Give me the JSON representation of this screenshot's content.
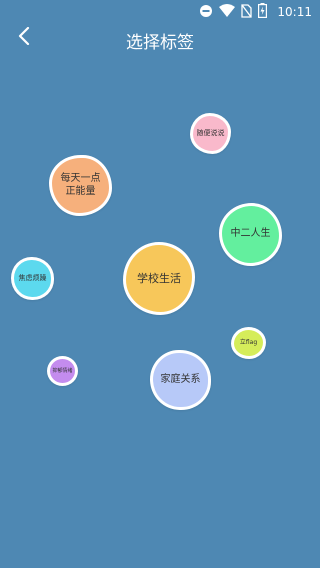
{
  "status_bar": {
    "time": "10:11",
    "icons": [
      "do-not-disturb-icon",
      "wifi-icon",
      "no-sim-icon",
      "battery-charging-icon"
    ]
  },
  "header": {
    "title": "选择标签",
    "back_icon": "chevron-left-icon"
  },
  "colors": {
    "background": "#4e88b3",
    "tag_border": "#ffffff"
  },
  "tags": [
    {
      "id": "suibian",
      "label": "随便说说",
      "color": "#f9b9cb"
    },
    {
      "id": "meitian",
      "label_line1": "每天一点",
      "label_line2": "正能量",
      "color": "#f6b07c"
    },
    {
      "id": "zhonger",
      "label": "中二人生",
      "color": "#63ef9e"
    },
    {
      "id": "xuexiao",
      "label": "学校生活",
      "color": "#f7c75a"
    },
    {
      "id": "jiaolv",
      "label": "焦虑烦躁",
      "color": "#5cd9ee"
    },
    {
      "id": "liflag",
      "label": "立flag",
      "color": "#d5ed5a"
    },
    {
      "id": "yiyu",
      "label": "抑郁情绪",
      "color": "#c48cee"
    },
    {
      "id": "jiating",
      "label": "家庭关系",
      "color": "#b7c9f8"
    }
  ]
}
